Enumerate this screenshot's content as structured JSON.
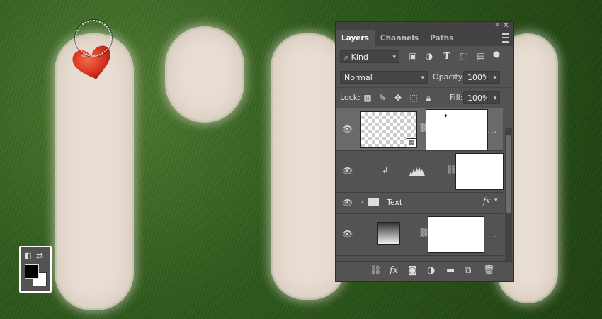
{
  "panel": {
    "tabs": [
      "Layers",
      "Channels",
      "Paths"
    ],
    "active_tab": "Layers",
    "filter": {
      "kind_label": "Kind"
    },
    "blend_mode": "Normal",
    "opacity_label": "Opacity:",
    "opacity_value": "100%",
    "lock_label": "Lock:",
    "fill_label": "Fill:",
    "fill_value": "100%",
    "layers": [
      {
        "type": "smart-object",
        "selected": true
      },
      {
        "type": "levels-adjustment",
        "clipped": true
      },
      {
        "type": "group",
        "name": "Text",
        "has_fx": true
      },
      {
        "type": "gradient-fill"
      }
    ],
    "fx_label": "fx",
    "more_label": "..."
  },
  "colors": {
    "foreground": "#000000",
    "background": "#ffffff",
    "panel_bg": "#535353",
    "heart": "#d9341f"
  },
  "icons": {
    "heart": "heart-icon",
    "brush_cursor": "brush-cursor-icon"
  }
}
